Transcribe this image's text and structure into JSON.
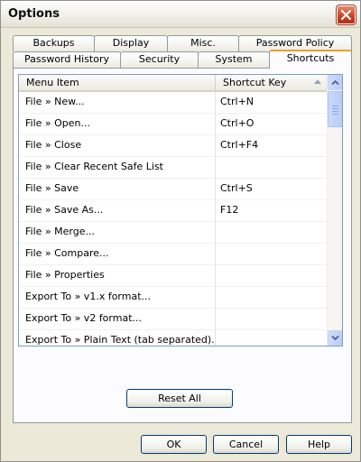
{
  "window": {
    "title": "Options"
  },
  "tabs": {
    "row_back": [
      "Backups",
      "Display",
      "Misc.",
      "Password Policy"
    ],
    "row_front": [
      "Password History",
      "Security",
      "System",
      "Shortcuts"
    ],
    "active": "Shortcuts"
  },
  "list": {
    "headers": {
      "menu_item": "Menu Item",
      "shortcut_key": "Shortcut Key"
    },
    "rows": [
      {
        "menu_item": "File » New...",
        "shortcut": "Ctrl+N"
      },
      {
        "menu_item": "File » Open...",
        "shortcut": "Ctrl+O"
      },
      {
        "menu_item": "File » Close",
        "shortcut": "Ctrl+F4"
      },
      {
        "menu_item": "File » Clear Recent Safe List",
        "shortcut": ""
      },
      {
        "menu_item": "File » Save",
        "shortcut": "Ctrl+S"
      },
      {
        "menu_item": "File » Save As...",
        "shortcut": "F12"
      },
      {
        "menu_item": "File » Merge...",
        "shortcut": ""
      },
      {
        "menu_item": "File » Compare...",
        "shortcut": ""
      },
      {
        "menu_item": "File » Properties",
        "shortcut": ""
      },
      {
        "menu_item": "Export To » v1.x format...",
        "shortcut": ""
      },
      {
        "menu_item": "Export To » v2 format...",
        "shortcut": ""
      },
      {
        "menu_item": "Export To » Plain Text (tab separated)...",
        "shortcut": ""
      }
    ]
  },
  "buttons": {
    "reset_all": "Reset All",
    "ok": "OK",
    "cancel": "Cancel",
    "help": "Help"
  }
}
